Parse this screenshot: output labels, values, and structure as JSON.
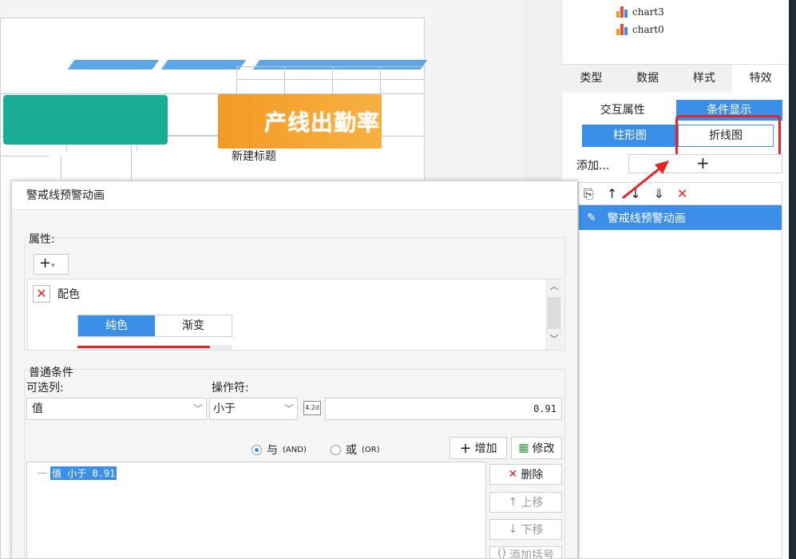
{
  "canvas": {
    "orange_card_text": "产线出勤率",
    "new_title": "新建标题"
  },
  "tree": {
    "items": [
      {
        "label": "chart3"
      },
      {
        "label": "chart0"
      }
    ]
  },
  "panel": {
    "tabs": [
      {
        "label": "类型"
      },
      {
        "label": "数据"
      },
      {
        "label": "样式"
      },
      {
        "label": "特效"
      }
    ],
    "sub_tabs": [
      {
        "label": "交互属性"
      },
      {
        "label": "条件显示"
      }
    ],
    "chart_tabs": [
      {
        "label": "柱形图"
      },
      {
        "label": "折线图"
      }
    ],
    "add_label": "添加...",
    "add_plus": "+",
    "toolbar_icons": [
      "copy-icon",
      "arrow-up-icon",
      "arrow-down-icon",
      "move-bottom-icon",
      "close-icon"
    ],
    "list_items": [
      {
        "label": "警戒线预警动画"
      }
    ],
    "accent_color": "#3c8fe8",
    "highlight_color": "#e42323"
  },
  "dialog": {
    "title": "警戒线预警动画",
    "properties_label": "属性:",
    "add_symbol": "+",
    "property_name": "配色",
    "color_tabs": [
      {
        "label": "纯色"
      },
      {
        "label": "渐变"
      }
    ],
    "conditions_label": "普通条件",
    "column_label": "可选列:",
    "operator_label": "操作符:",
    "column_value": "值",
    "operator_value": "小于",
    "number_icon_text": "4.2d",
    "value_input": "0.91",
    "radio_and": {
      "label": "与",
      "sub": "(AND)"
    },
    "radio_or": {
      "label": "或",
      "sub": "(OR)"
    },
    "add_button": "增加",
    "modify_button": "修改",
    "delete_button": "删除",
    "move_up_button": "上移",
    "move_down_button": "下移",
    "add_bracket_button": "添加括号",
    "condition_row": "值 小于 0.91"
  }
}
